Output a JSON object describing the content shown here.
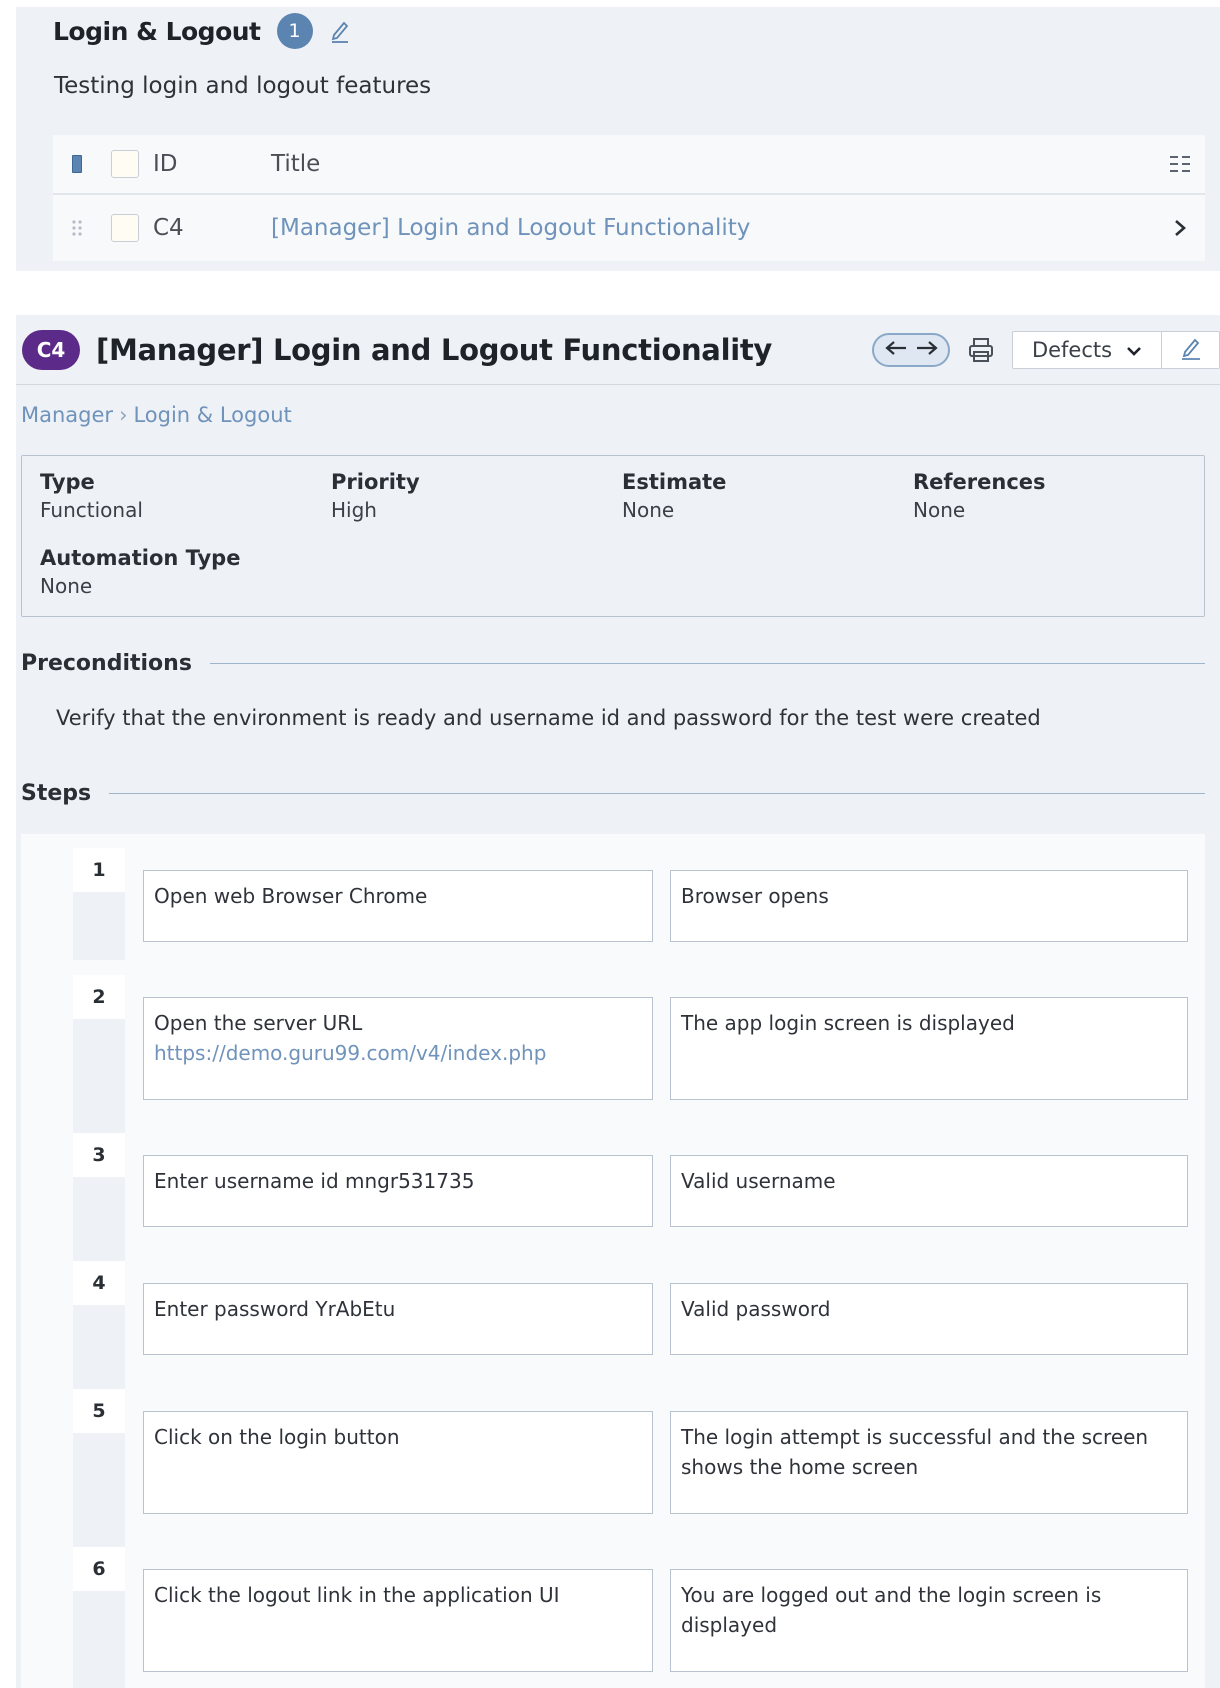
{
  "section": {
    "title": "Login & Logout",
    "count": "1",
    "description": "Testing login and logout features",
    "table": {
      "headers": {
        "id": "ID",
        "title": "Title"
      },
      "rows": [
        {
          "id": "C4",
          "title": "[Manager] Login and Logout Functionality"
        }
      ]
    }
  },
  "case": {
    "badge": "C4",
    "title": "[Manager] Login and Logout Functionality",
    "defects_label": "Defects",
    "breadcrumb": [
      "Manager",
      "Login & Logout"
    ],
    "fields": {
      "type": {
        "label": "Type",
        "value": "Functional"
      },
      "priority": {
        "label": "Priority",
        "value": "High"
      },
      "estimate": {
        "label": "Estimate",
        "value": "None"
      },
      "references": {
        "label": "References",
        "value": "None"
      },
      "automation_type": {
        "label": "Automation Type",
        "value": "None"
      }
    },
    "preconditions": {
      "heading": "Preconditions",
      "text": "Verify that the environment is ready and username id and password for the test were created"
    },
    "steps_heading": "Steps",
    "steps": [
      {
        "num": "1",
        "action": "Open web Browser Chrome",
        "link": "",
        "expected": "Browser opens"
      },
      {
        "num": "2",
        "action": "Open the server URL",
        "link": "https://demo.guru99.com/v4/index.php",
        "expected": "The app login screen is displayed"
      },
      {
        "num": "3",
        "action": "Enter username id mngr531735",
        "link": "",
        "expected": "Valid username"
      },
      {
        "num": "4",
        "action": "Enter password YrAbEtu",
        "link": "",
        "expected": "Valid password"
      },
      {
        "num": "5",
        "action": "Click on the login button",
        "link": "",
        "expected": "The login attempt is successful and the screen shows the home screen"
      },
      {
        "num": "6",
        "action": "Click the logout link in the application UI",
        "link": "",
        "expected": "You are logged out and the login screen is displayed"
      }
    ]
  },
  "colors": {
    "accent": "#5b84b1",
    "case_badge": "#5c2a88",
    "link": "#6f93bb",
    "panel_bg": "#eef1f5"
  },
  "icons": [
    "pencil-icon",
    "drag-handle-icon",
    "column-settings-icon",
    "chevron-right-icon",
    "arrow-left-icon",
    "arrow-right-icon",
    "print-icon",
    "chevron-down-icon"
  ]
}
